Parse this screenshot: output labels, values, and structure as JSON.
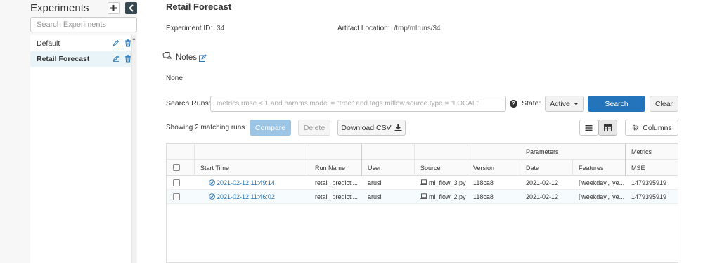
{
  "sidebar": {
    "title": "Experiments",
    "search_placeholder": "Search Experiments",
    "experiments": [
      {
        "name": "Default",
        "active": false
      },
      {
        "name": "Retail Forecast",
        "active": true
      }
    ]
  },
  "experiment": {
    "title": "Retail Forecast",
    "id_label": "Experiment ID:",
    "id_value": "34",
    "artifact_label": "Artifact Location:",
    "artifact_value": "/tmp/mlruns/34",
    "notes_label": "Notes",
    "notes_value": "None"
  },
  "search": {
    "label": "Search Runs:",
    "placeholder": "metrics.rmse < 1 and params.model = \"tree\" and tags.mlflow.source.type = \"LOCAL\"",
    "state_label": "State:",
    "state_value": "Active",
    "search_button": "Search",
    "clear_button": "Clear"
  },
  "toolbar": {
    "matching_text": "Showing 2 matching runs",
    "compare_button": "Compare",
    "delete_button": "Delete",
    "download_button": "Download CSV",
    "columns_button": "Columns"
  },
  "table": {
    "group_headers": {
      "parameters": "Parameters",
      "metrics": "Metrics"
    },
    "columns": [
      "Start Time",
      "Run Name",
      "User",
      "Source",
      "Version",
      "Date",
      "Features",
      "MSE"
    ],
    "rows": [
      {
        "start_time": "2021-02-12 11:49:14",
        "run_name": "retail_predicti...",
        "user": "arusi",
        "source": "ml_flow_3.py",
        "version": "118ca8",
        "date": "2021-02-12",
        "features": "['weekday', 'ye...",
        "mse": "1479395919"
      },
      {
        "start_time": "2021-02-12 11:46:02",
        "run_name": "retail_predicti...",
        "user": "arusi",
        "source": "ml_flow_2.py",
        "version": "118ca8",
        "date": "2021-02-12",
        "features": "['weekday', 'ye...",
        "mse": "1479395919"
      }
    ]
  },
  "colors": {
    "primary": "#2374bb",
    "primary_disabled": "#9cc5e5",
    "link": "#2374bb",
    "sidebar_active": "#e8f4f8"
  }
}
